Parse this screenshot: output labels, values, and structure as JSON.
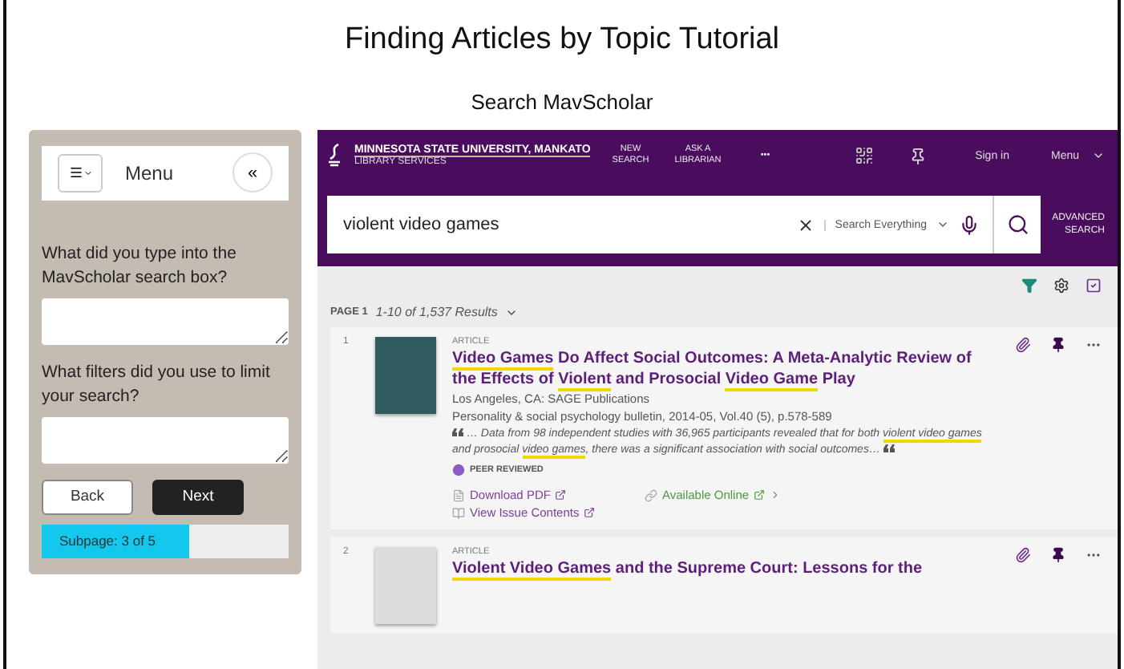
{
  "page_title": "Finding Articles by Topic Tutorial",
  "page_subtitle": "Search MavScholar",
  "sidebar": {
    "menu_label": "Menu",
    "collapse_glyph": "«",
    "questions": [
      {
        "label": "What did you type into the MavScholar search box?"
      },
      {
        "label": "What filters did you use to limit your search?"
      }
    ],
    "buttons": [
      {
        "label": "Back",
        "kind": "secondary"
      },
      {
        "label": "Next",
        "kind": "primary"
      }
    ],
    "progress": {
      "label": "Subpage: 3 of 5",
      "level": 0.6
    }
  },
  "site": {
    "university": "MINNESOTA STATE UNIVERSITY, MANKATO",
    "unit": "LIBRARY SERVICES",
    "nav": [
      "NEW SEARCH",
      "ASK A LIBRARIAN",
      "•••"
    ],
    "sign_in": "Sign in",
    "menu": "Menu",
    "search": {
      "value": "violent video games",
      "scope": "Search Everything",
      "advanced": "ADVANCED SEARCH"
    },
    "page_label": "PAGE 1",
    "results_count": "1-10 of 1,537 Results",
    "results": [
      {
        "number": "1",
        "type": "ARTICLE",
        "title": [
          {
            "text": "Video Games",
            "highlight": true
          },
          {
            "text": " Do Affect Social Outcomes: A Meta-Analytic Review of the Effects of ",
            "highlight": false
          },
          {
            "text": "Violent",
            "highlight": true
          },
          {
            "text": " and Prosocial ",
            "highlight": false
          },
          {
            "text": "Video Game",
            "highlight": true
          },
          {
            "text": " Play",
            "highlight": false
          }
        ],
        "publisher": "Los Angeles, CA: SAGE Publications",
        "source": "Personality & social psychology bulletin, 2014-05, Vol.40 (5), p.578-589",
        "snippet": [
          {
            "text": "… Data from 98 independent studies with 36,965 participants revealed that for both ",
            "highlight": false
          },
          {
            "text": "violent video games",
            "highlight": true
          },
          {
            "text": " and prosocial ",
            "highlight": false
          },
          {
            "text": "video games",
            "highlight": true
          },
          {
            "text": ", there was a significant association with social outcomes…",
            "highlight": false
          }
        ],
        "badge": "PEER REVIEWED",
        "links": [
          {
            "label": "Download PDF",
            "kind": "pdf"
          },
          {
            "label": "Available Online",
            "kind": "online"
          },
          {
            "label": "View Issue Contents",
            "kind": "issue"
          }
        ]
      },
      {
        "number": "2",
        "type": "ARTICLE",
        "title": [
          {
            "text": "Violent Video Games",
            "highlight": true
          },
          {
            "text": " and the Supreme Court: Lessons for the",
            "highlight": false
          }
        ]
      }
    ]
  }
}
